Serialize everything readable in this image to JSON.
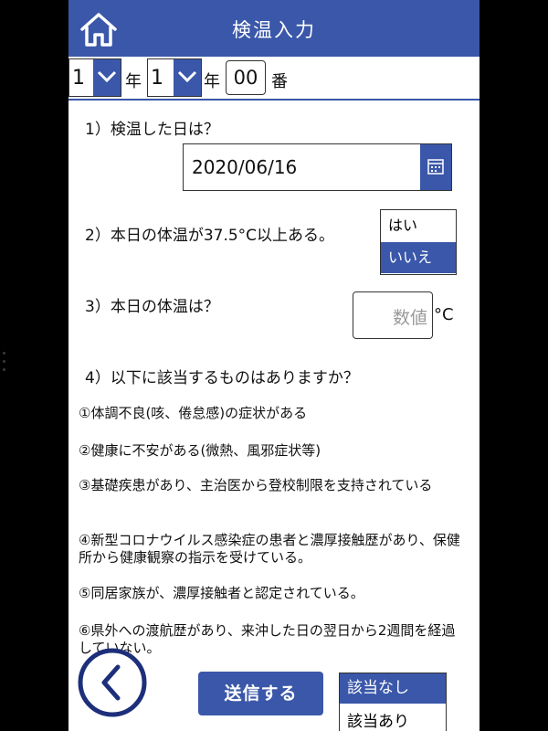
{
  "header": {
    "title": "検温入力",
    "color": "#3a57a9"
  },
  "selectors": {
    "grade": {
      "value": "1",
      "unit": "年"
    },
    "class": {
      "value": "1",
      "unit": "年"
    },
    "number": {
      "value": "00",
      "unit": "番"
    }
  },
  "q1": {
    "label": "1）検温した日は？",
    "date": "2020/06/16"
  },
  "q2": {
    "label": "2）本日の体温が37.5°C以上ある。",
    "options": [
      "はい",
      "いいえ"
    ],
    "selected": "いいえ"
  },
  "q3": {
    "label": "3）本日の体温は？",
    "placeholder": "数値",
    "unit": "°C"
  },
  "q4": {
    "label": "4）以下に該当するものはありますか？",
    "items": [
      "①体調不良(咳、倦怠感)の症状がある",
      "②健康に不安がある(微熱、風邪症状等)",
      "③基礎疾患があり、主治医から登校制限を支持されている",
      "④新型コロナウイルス感染症の患者と濃厚接触歴があり、保健所から健康観察の指示を受けている。",
      "⑤同居家族が、濃厚接触者と認定されている。",
      "⑥県外への渡航歴があり、来沖した日の翌日から2週間を経過していない。"
    ],
    "answer_options": [
      "該当なし",
      "該当あり"
    ],
    "selected": "該当なし"
  },
  "actions": {
    "send_label": "送信する"
  },
  "icons": {
    "home": "home-icon",
    "back": "chevron-left-icon",
    "calendar": "calendar-icon",
    "dropdown": "chevron-down-icon"
  }
}
